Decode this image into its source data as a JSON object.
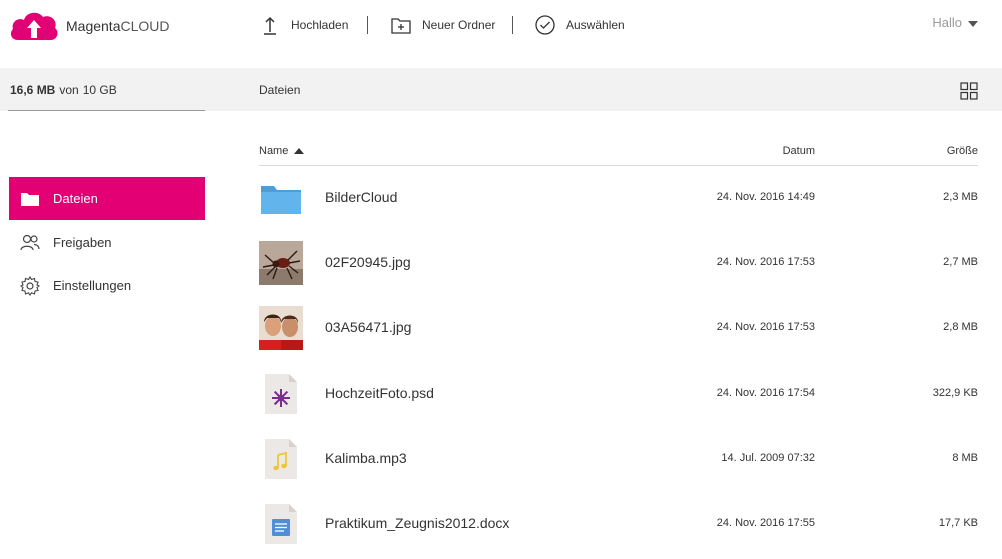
{
  "brand": {
    "name_main": "Magenta",
    "name_suffix": "CLOUD"
  },
  "toolbar": {
    "upload_label": "Hochladen",
    "new_folder_label": "Neuer Ordner",
    "select_label": "Auswählen"
  },
  "user": {
    "greeting": "Hallo"
  },
  "storage": {
    "used": "16,6 MB",
    "of": "von",
    "total": "10 GB"
  },
  "breadcrumb": "Dateien",
  "sidebar": {
    "items": [
      {
        "label": "Dateien",
        "icon": "folder-icon",
        "active": true
      },
      {
        "label": "Freigaben",
        "icon": "users-icon",
        "active": false
      },
      {
        "label": "Einstellungen",
        "icon": "gear-icon",
        "active": false
      }
    ]
  },
  "table": {
    "columns": {
      "name": "Name",
      "date": "Datum",
      "size": "Größe"
    },
    "sort": {
      "column": "name",
      "direction": "ascending"
    },
    "rows": [
      {
        "name": "BilderCloud",
        "date": "24. Nov. 2016 14:49",
        "size": "2,3 MB",
        "type": "folder"
      },
      {
        "name": "02F20945.jpg",
        "date": "24. Nov. 2016 17:53",
        "size": "2,7 MB",
        "type": "image-spider"
      },
      {
        "name": "03A56471.jpg",
        "date": "24. Nov. 2016 17:53",
        "size": "2,8 MB",
        "type": "image-people"
      },
      {
        "name": "HochzeitFoto.psd",
        "date": "24. Nov. 2016 17:54",
        "size": "322,9 KB",
        "type": "psd"
      },
      {
        "name": "Kalimba.mp3",
        "date": "14. Jul. 2009 07:32",
        "size": "8 MB",
        "type": "audio"
      },
      {
        "name": "Praktikum_Zeugnis2012.docx",
        "date": "24. Nov. 2016 17:55",
        "size": "17,7 KB",
        "type": "document"
      }
    ]
  },
  "colors": {
    "accent": "#e20074",
    "folder": "#5aaee6",
    "bar_bg": "#f2f2f2"
  }
}
